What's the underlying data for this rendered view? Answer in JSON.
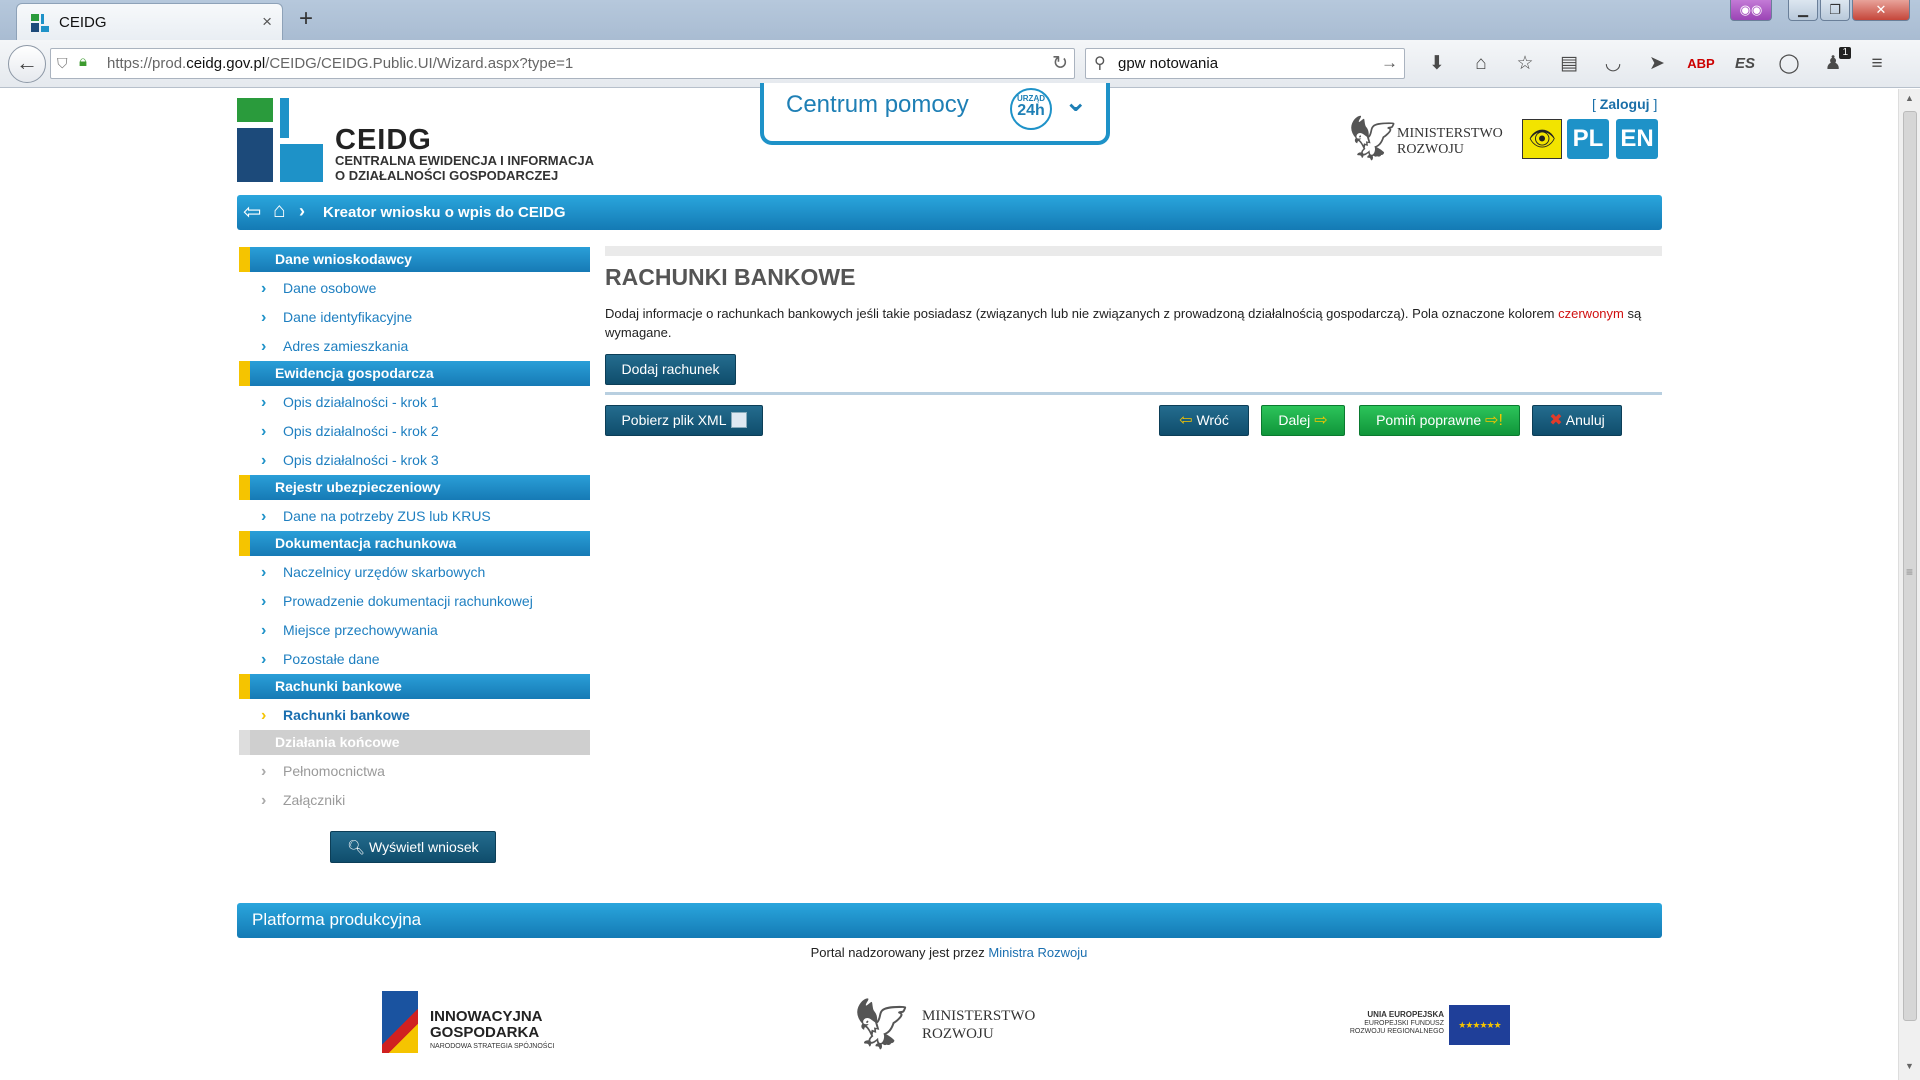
{
  "browser": {
    "tab_title": "CEIDG",
    "tab_close": "×",
    "new_tab": "+",
    "url_prefix": "https://prod.",
    "url_domain": "ceidg.gov.pl",
    "url_path": "/CEIDG/CEIDG.Public.UI/Wizard.aspx?type=1",
    "search_value": "gpw notowania",
    "notification_count": "1",
    "abp_label": "ABP",
    "es_label": "ES"
  },
  "header": {
    "logo_title": "CEIDG",
    "logo_sub_line1": "CENTRALNA EWIDENCJA I INFORMACJA",
    "logo_sub_line2": "O DZIAŁALNOŚCI GOSPODARCZEJ",
    "help_label": "Centrum pomocy",
    "help_badge_small": "URZĄD",
    "help_badge_big": "24h",
    "login_open": "[ ",
    "login_label": "Zaloguj",
    "login_close": " ]",
    "ministry_line1": "MINISTERSTWO",
    "ministry_line2": "ROZWOJU",
    "lang_pl": "PL",
    "lang_en": "EN"
  },
  "breadcrumb": {
    "title": "Kreator wniosku o wpis do CEIDG"
  },
  "sidebar": {
    "sections": [
      {
        "title": "Dane wnioskodawcy",
        "items": [
          "Dane osobowe",
          "Dane identyfikacyjne",
          "Adres zamieszkania"
        ]
      },
      {
        "title": "Ewidencja gospodarcza",
        "items": [
          "Opis działalności - krok 1",
          "Opis działalności - krok 2",
          "Opis działalności - krok 3"
        ]
      },
      {
        "title": "Rejestr ubezpieczeniowy",
        "items": [
          "Dane na potrzeby ZUS lub KRUS"
        ]
      },
      {
        "title": "Dokumentacja rachunkowa",
        "items": [
          "Naczelnicy urzędów skarbowych",
          "Prowadzenie dokumentacji rachunkowej",
          "Miejsce przechowywania",
          "Pozostałe dane"
        ]
      },
      {
        "title": "Rachunki bankowe",
        "items": [
          "Rachunki bankowe"
        ]
      },
      {
        "title": "Działania końcowe",
        "items": [
          "Pełnomocnictwa",
          "Załączniki"
        ]
      }
    ],
    "view_button": "Wyświetl wniosek"
  },
  "main": {
    "title": "RACHUNKI BANKOWE",
    "desc_part1": "Dodaj informacje o rachunkach bankowych jeśli takie posiadasz (związanych lub nie związanych z prowadzoną działalnością gospodarczą). Pola oznaczone kolorem ",
    "desc_red": "czerwonym",
    "desc_part2": " są wymagane.",
    "add_button": "Dodaj rachunek",
    "xml_button": "Pobierz plik XML",
    "back_button": "Wróć",
    "next_button": "Dalej",
    "skip_button": "Pomiń poprawne",
    "cancel_button": "Anuluj"
  },
  "footer": {
    "platform": "Platforma produkcyjna",
    "supervised_text": "Portal nadzorowany jest przez ",
    "supervised_link": "Ministra Rozwoju",
    "logo1_line1": "INNOWACYJNA",
    "logo1_line2": "GOSPODARKA",
    "logo1_line3": "NARODOWA STRATEGIA SPÓJNOŚCI",
    "logo2_line1": "MINISTERSTWO",
    "logo2_line2": "ROZWOJU",
    "logo3_line1": "UNIA EUROPEJSKA",
    "logo3_line2": "EUROPEJSKI FUNDUSZ",
    "logo3_line3": "ROZWOJU REGIONALNEGO",
    "eu_stars": "★★★★★★"
  },
  "colors": {
    "brand_blue": "#1e92c8",
    "accent_yellow": "#f5c400",
    "dark_button": "#0f4d6c",
    "green_button": "#10953a",
    "required_red": "#d01010"
  }
}
